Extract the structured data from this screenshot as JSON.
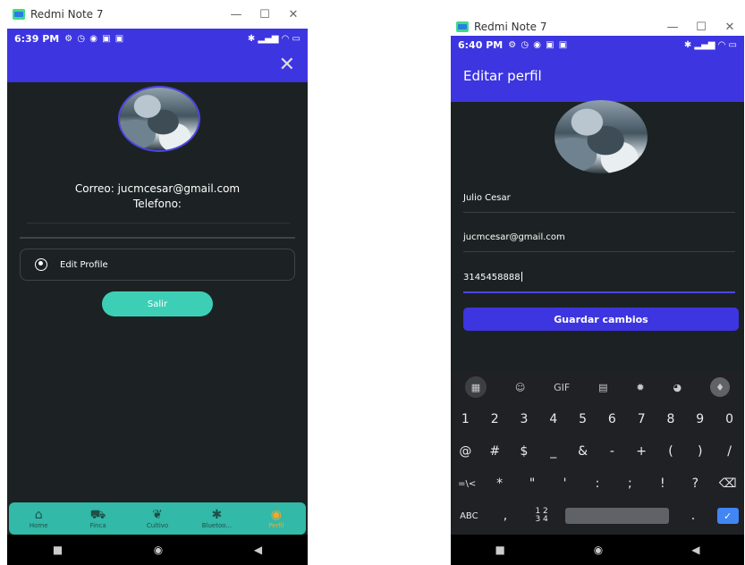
{
  "left": {
    "window_title": "Redmi Note 7",
    "status_time": "6:39 PM",
    "profile": {
      "correo": "Correo: jucmcesar@gmail.com",
      "telefono": "Telefono:"
    },
    "edit_profile_label": "Edit Profile",
    "salir_label": "Salir",
    "bottom_nav": [
      "Home",
      "Finca",
      "Cultivo",
      "Bluetoo...",
      "Perfil"
    ]
  },
  "right": {
    "window_title": "Redmi Note 7",
    "status_time": "6:40 PM",
    "app_title": "Editar perfil",
    "name_value": "Julio Cesar",
    "email_value": "jucmcesar@gmail.com",
    "phone_value": "3145458888",
    "save_label": "Guardar cambios",
    "keyboard": {
      "toolbar": [
        "GIF"
      ],
      "row_numbers": [
        "1",
        "2",
        "3",
        "4",
        "5",
        "6",
        "7",
        "8",
        "9",
        "0"
      ],
      "row_symbols": [
        "@",
        "#",
        "$",
        "_",
        "&",
        "-",
        "+",
        "(",
        ")",
        "/"
      ],
      "row_symbols2": [
        "=\\<",
        "*",
        "\"",
        "'",
        ":",
        ";",
        "!",
        "?"
      ],
      "abc_key": "ABC",
      "comma_key": ",",
      "num_key": "1 2\n3 4",
      "period_key": "."
    }
  },
  "colors": {
    "brand": "#3d35e0",
    "teal": "#32b9a7",
    "dark_bg": "#1c2223"
  }
}
